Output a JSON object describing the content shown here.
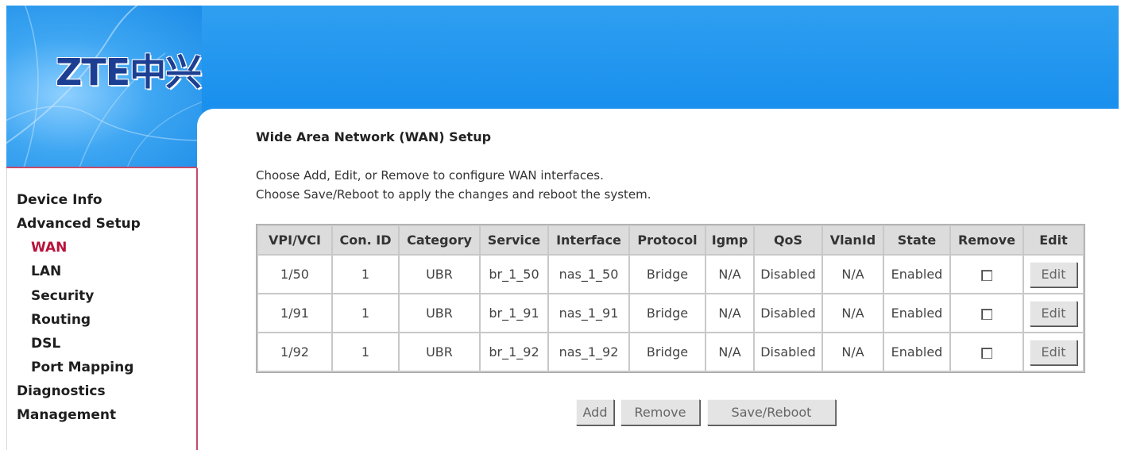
{
  "brand": {
    "logo_text": "ZTE中兴"
  },
  "nav": {
    "items": [
      {
        "label": "Device Info",
        "level": 0,
        "active": false
      },
      {
        "label": "Advanced Setup",
        "level": 0,
        "active": false
      },
      {
        "label": "WAN",
        "level": 1,
        "active": true
      },
      {
        "label": "LAN",
        "level": 1,
        "active": false
      },
      {
        "label": "Security",
        "level": 1,
        "active": false
      },
      {
        "label": "Routing",
        "level": 1,
        "active": false
      },
      {
        "label": "DSL",
        "level": 1,
        "active": false
      },
      {
        "label": "Port Mapping",
        "level": 1,
        "active": false
      },
      {
        "label": "Diagnostics",
        "level": 0,
        "active": false
      },
      {
        "label": "Management",
        "level": 0,
        "active": false
      }
    ]
  },
  "page": {
    "title": "Wide Area Network (WAN) Setup",
    "desc_line1": "Choose Add, Edit, or Remove to configure WAN interfaces.",
    "desc_line2": "Choose Save/Reboot to apply the changes and reboot the system."
  },
  "table": {
    "headers": [
      "VPI/VCI",
      "Con. ID",
      "Category",
      "Service",
      "Interface",
      "Protocol",
      "Igmp",
      "QoS",
      "VlanId",
      "State",
      "Remove",
      "Edit"
    ],
    "rows": [
      {
        "vpi_vci": "1/50",
        "con_id": "1",
        "category": "UBR",
        "service": "br_1_50",
        "interface": "nas_1_50",
        "protocol": "Bridge",
        "igmp": "N/A",
        "qos": "Disabled",
        "vlan_id": "N/A",
        "state": "Enabled",
        "edit_label": "Edit"
      },
      {
        "vpi_vci": "1/91",
        "con_id": "1",
        "category": "UBR",
        "service": "br_1_91",
        "interface": "nas_1_91",
        "protocol": "Bridge",
        "igmp": "N/A",
        "qos": "Disabled",
        "vlan_id": "N/A",
        "state": "Enabled",
        "edit_label": "Edit"
      },
      {
        "vpi_vci": "1/92",
        "con_id": "1",
        "category": "UBR",
        "service": "br_1_92",
        "interface": "nas_1_92",
        "protocol": "Bridge",
        "igmp": "N/A",
        "qos": "Disabled",
        "vlan_id": "N/A",
        "state": "Enabled",
        "edit_label": "Edit"
      }
    ]
  },
  "actions": {
    "add_label": "Add",
    "remove_label": "Remove",
    "save_reboot_label": "Save/Reboot"
  },
  "colors": {
    "header_blue": "#1a90ee",
    "active_nav": "#b8123a",
    "sidebar_border": "#c44a6a"
  }
}
